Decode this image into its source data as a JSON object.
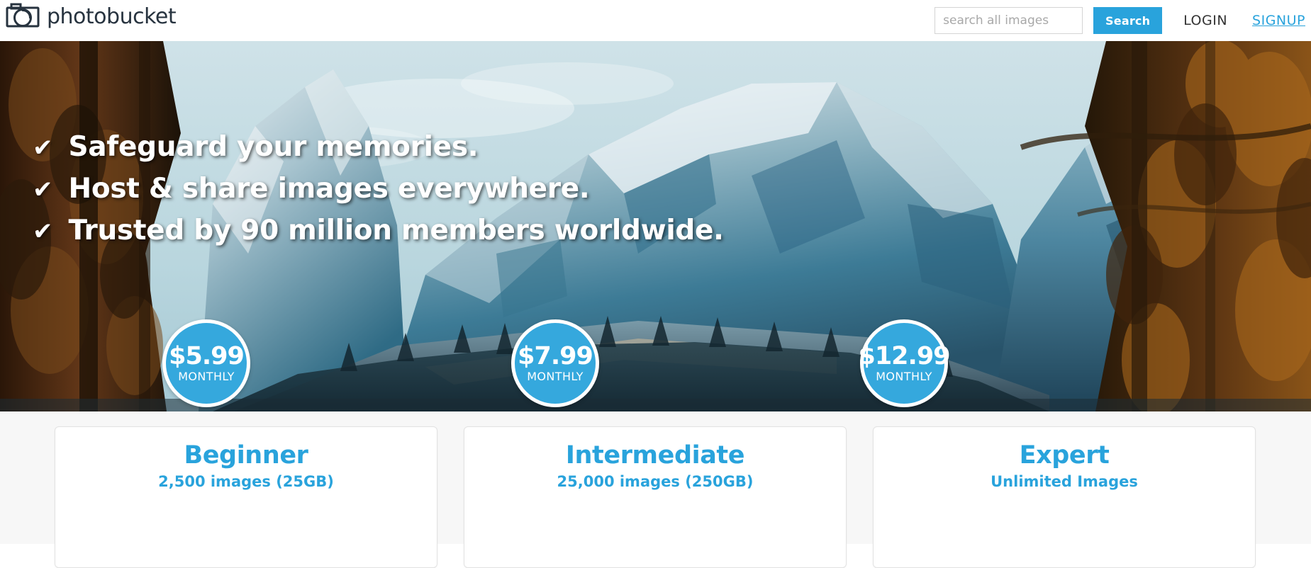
{
  "header": {
    "logo_text": "photobucket",
    "logo_icon": "camera-icon",
    "search": {
      "placeholder": "search all images",
      "value": "",
      "button_label": "Search"
    },
    "login_label": "LOGIN",
    "signup_label": "SIGNUP"
  },
  "hero": {
    "check_glyph": "✔",
    "lines": [
      "Safeguard your memories.",
      "Host & share images everywhere.",
      "Trusted by 90 million members worldwide."
    ]
  },
  "pricing": {
    "plans": [
      {
        "price": "$5.99",
        "period": "MONTHLY",
        "title": "Beginner",
        "capacity": "2,500 images (25GB)"
      },
      {
        "price": "$7.99",
        "period": "MONTHLY",
        "title": "Intermediate",
        "capacity": "25,000 images (250GB)"
      },
      {
        "price": "$12.99",
        "period": "MONTHLY",
        "title": "Expert",
        "capacity": "Unlimited Images"
      }
    ]
  },
  "colors": {
    "accent_blue": "#29a3dc",
    "bubble_blue": "#35a8dd",
    "logo_navy": "#27333f",
    "pricing_bg": "#f7f7f7"
  }
}
